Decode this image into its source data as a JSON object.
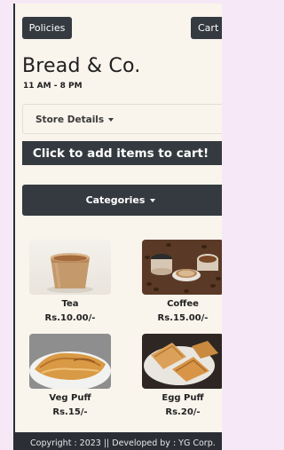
{
  "header": {
    "policies_label": "Policies",
    "cart_label": "Cart"
  },
  "store": {
    "name": "Bread & Co.",
    "hours": "11 AM - 8 PM",
    "details_label": "Store Details"
  },
  "banner": {
    "text": "Click to add items to cart!"
  },
  "categories": {
    "label": "Categories"
  },
  "products": [
    {
      "name": "Tea",
      "price": "Rs.10.00/-",
      "image_icon": "tea-cup-image"
    },
    {
      "name": "Coffee",
      "price": "Rs.15.00/-",
      "image_icon": "coffee-cups-image"
    },
    {
      "name": "Veg Puff",
      "price": "Rs.15/-",
      "image_icon": "veg-puff-image"
    },
    {
      "name": "Egg Puff",
      "price": "Rs.20/-",
      "image_icon": "egg-puff-image"
    }
  ],
  "footer": {
    "text": "Copyright : 2023 || Developed by : YG Corp."
  },
  "colors": {
    "dark": "#343a40",
    "background": "#f9f4ec",
    "page_tint": "#f6e8f6"
  }
}
